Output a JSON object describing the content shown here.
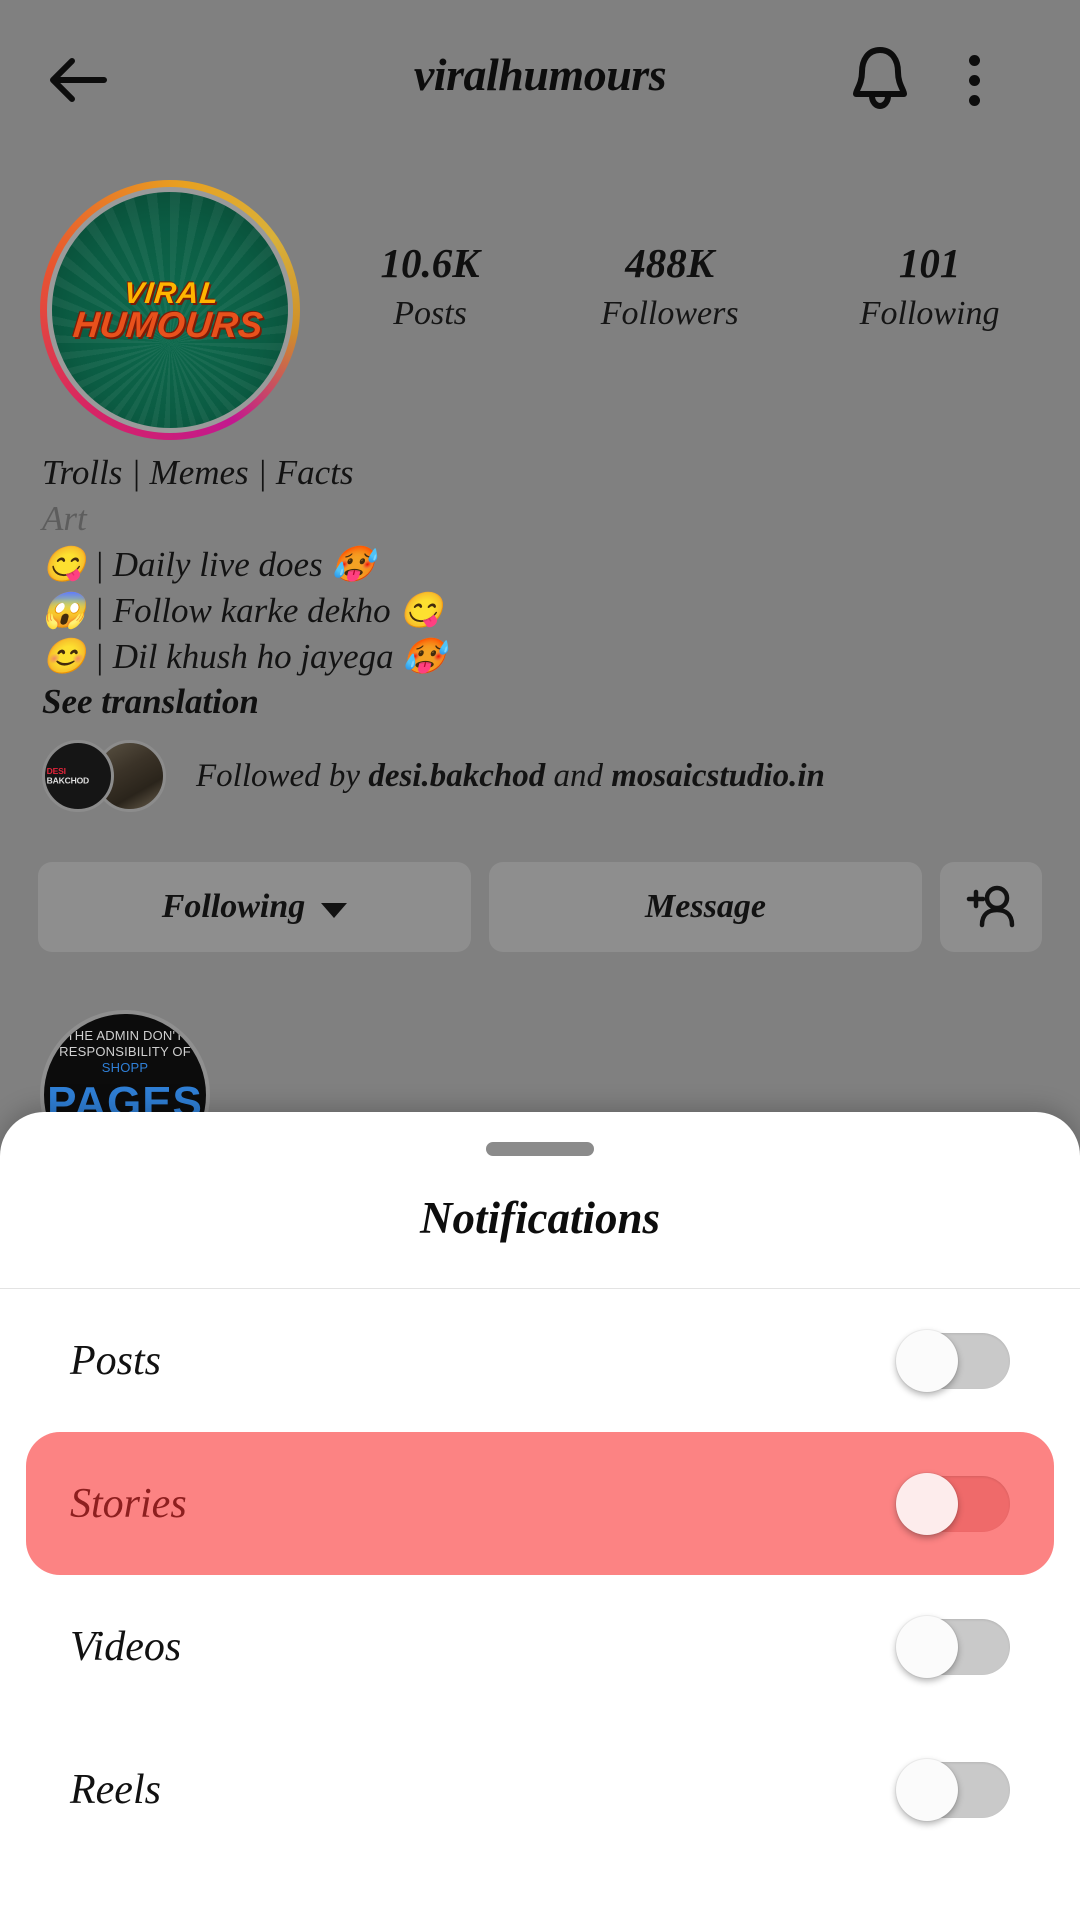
{
  "profile": {
    "header": {
      "title": "viralhumours",
      "back_icon": "back-arrow-icon",
      "bell_icon": "bell-icon",
      "menu_icon": "more-options-icon"
    },
    "avatar": {
      "line1": "VIRAL",
      "line2": "HUMOURS"
    },
    "stats": [
      {
        "value": "10.6K",
        "label": "Posts"
      },
      {
        "value": "488K",
        "label": "Followers"
      },
      {
        "value": "101",
        "label": "Following"
      }
    ],
    "bio": {
      "lines": [
        "Trolls | Memes | Facts",
        "Art",
        "😋 | Daily live does 🥵",
        "😱 | Follow karke dekho 😋",
        "😊 | Dil khush ho jayega 🥵"
      ],
      "see_translation": "See translation"
    },
    "followed_by": {
      "text_prefix": "Followed by ",
      "user1": "desi.bakchod",
      "conjunction": " and ",
      "user2": "mosaicstudio.in",
      "avatar1_label": "DESI BAKCHOD"
    },
    "actions": {
      "following": "Following",
      "message": "Message",
      "add_user_icon": "add-person-icon"
    },
    "highlight": {
      "top_line1": "THE ADMIN DON'T",
      "top_line2": "RESPONSIBILITY OF",
      "top_line2_accent": "SHOPP",
      "big": "PAGES"
    }
  },
  "sheet": {
    "title": "Notifications",
    "grabber": "drag-handle",
    "rows": [
      {
        "label": "Posts",
        "enabled": false,
        "highlighted": false
      },
      {
        "label": "Stories",
        "enabled": false,
        "highlighted": true
      },
      {
        "label": "Videos",
        "enabled": false,
        "highlighted": false
      },
      {
        "label": "Reels",
        "enabled": false,
        "highlighted": false
      }
    ]
  },
  "colors": {
    "scrim": "#808080",
    "highlight_row": "#fc8383",
    "highlight_text": "#8d1f1f",
    "sheet_bg": "#ffffff",
    "toggle_off_track": "#c9c9c9"
  }
}
